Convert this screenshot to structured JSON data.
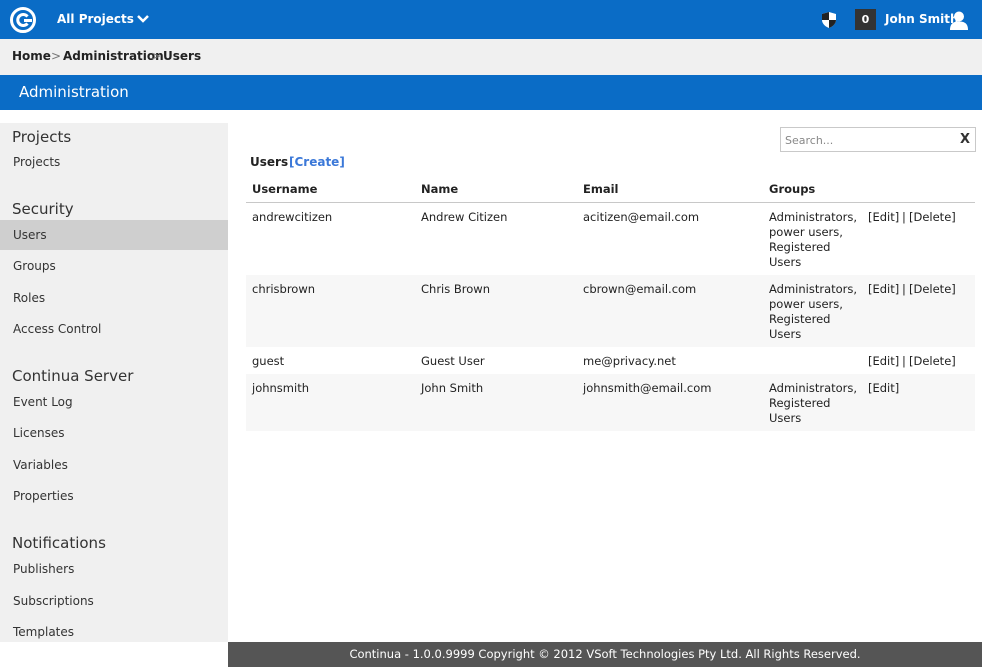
{
  "topbar": {
    "project_selector": "All Projects",
    "notification_count": "0",
    "user_name": "John Smith"
  },
  "breadcrumb": {
    "home": "Home",
    "sep": ">",
    "administration": "Administration",
    "current": "Users"
  },
  "header": {
    "title": "Administration"
  },
  "sidebar": {
    "sections": [
      {
        "heading": "Projects",
        "items": [
          "Projects"
        ]
      },
      {
        "heading": "Security",
        "items": [
          "Users",
          "Groups",
          "Roles",
          "Access Control"
        ]
      },
      {
        "heading": "Continua Server",
        "items": [
          "Event Log",
          "Licenses",
          "Variables",
          "Properties"
        ]
      },
      {
        "heading": "Notifications",
        "items": [
          "Publishers",
          "Subscriptions",
          "Templates"
        ]
      }
    ]
  },
  "search": {
    "placeholder": "Search...",
    "clear_label": "X"
  },
  "users": {
    "title": "Users",
    "create_label": "[Create]",
    "columns": [
      "Username",
      "Name",
      "Email",
      "Groups"
    ],
    "edit_label": "[Edit]",
    "separator": "|",
    "delete_label": "[Delete]",
    "rows": [
      {
        "username": "andrewcitizen",
        "name": "Andrew Citizen",
        "email": "acitizen@email.com",
        "groups": [
          "Administrators,",
          "power users,",
          "Registered",
          "Users"
        ],
        "deletable": true
      },
      {
        "username": "chrisbrown",
        "name": "Chris Brown",
        "email": "cbrown@email.com",
        "groups": [
          "Administrators,",
          "power users,",
          "Registered",
          "Users"
        ],
        "deletable": true
      },
      {
        "username": "guest",
        "name": "Guest User",
        "email": "me@privacy.net",
        "groups": [],
        "deletable": true
      },
      {
        "username": "johnsmith",
        "name": "John Smith",
        "email": "johnsmith@email.com",
        "groups": [
          "Administrators,",
          "Registered",
          "Users"
        ],
        "deletable": false
      }
    ]
  },
  "footer": {
    "text": "Continua - 1.0.0.9999 Copyright © 2012 VSoft Technologies Pty Ltd. All Rights Reserved."
  },
  "colors": {
    "brand_blue": "#0a6cc6",
    "link_blue": "#3b78d8",
    "footer_bg": "#555555"
  }
}
